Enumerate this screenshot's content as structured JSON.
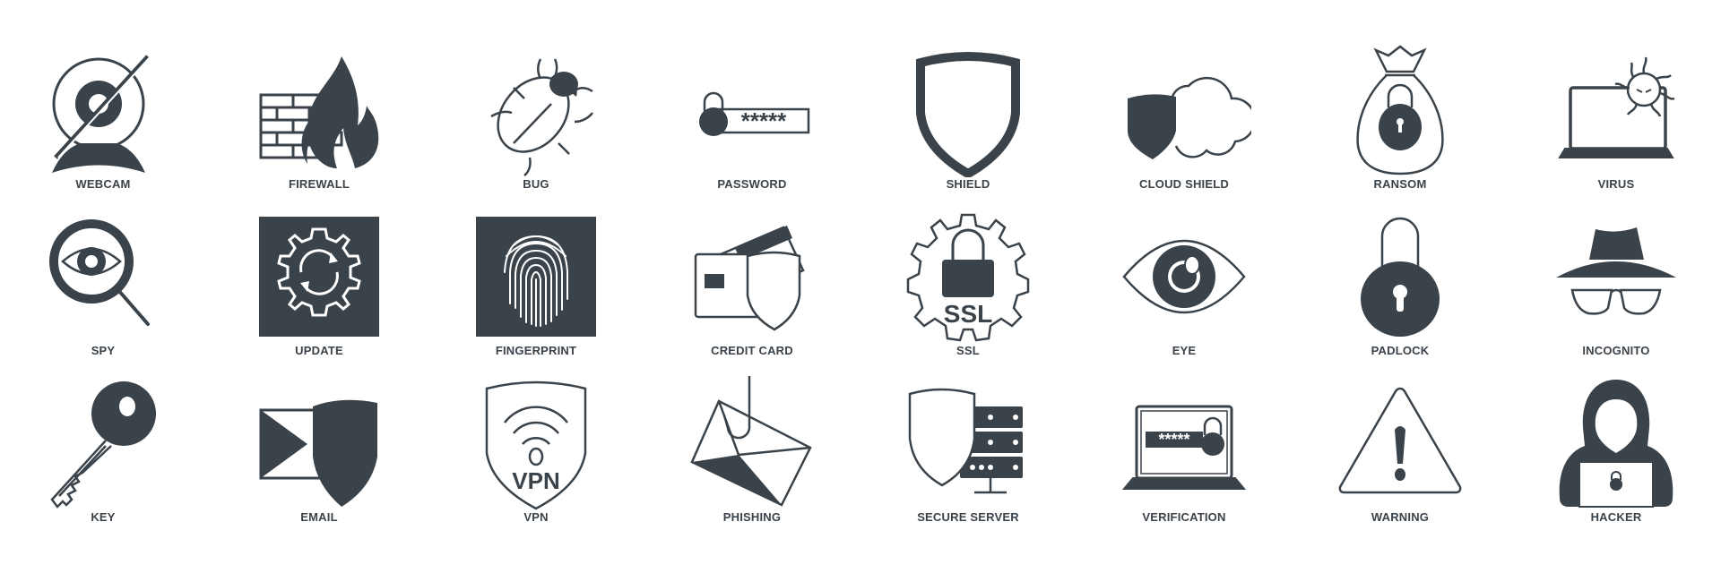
{
  "theme": {
    "icon_color": "#3a424a",
    "background": "#ffffff"
  },
  "rows": [
    [
      {
        "id": "webcam",
        "label": "WEBCAM",
        "icon": "webcam-off-icon"
      },
      {
        "id": "firewall",
        "label": "FIREWALL",
        "icon": "firewall-icon"
      },
      {
        "id": "bug",
        "label": "BUG",
        "icon": "bug-icon"
      },
      {
        "id": "password",
        "label": "PASSWORD",
        "icon": "password-icon",
        "mask": "*****"
      },
      {
        "id": "shield",
        "label": "SHIELD",
        "icon": "shield-icon"
      },
      {
        "id": "cloud-shield",
        "label": "CLOUD SHIELD",
        "icon": "cloud-shield-icon"
      },
      {
        "id": "ransom",
        "label": "RANSOM",
        "icon": "ransom-bag-icon"
      },
      {
        "id": "virus",
        "label": "VIRUS",
        "icon": "laptop-virus-icon"
      }
    ],
    [
      {
        "id": "spy",
        "label": "SPY",
        "icon": "spy-magnifier-eye-icon"
      },
      {
        "id": "update",
        "label": "UPDATE",
        "icon": "gear-update-icon"
      },
      {
        "id": "fingerprint",
        "label": "FINGERPRINT",
        "icon": "fingerprint-icon"
      },
      {
        "id": "credit-card",
        "label": "CREDIT CARD",
        "icon": "credit-card-shield-icon"
      },
      {
        "id": "ssl",
        "label": "SSL",
        "icon": "ssl-gear-lock-icon",
        "text": "SSL"
      },
      {
        "id": "eye",
        "label": "EYE",
        "icon": "eye-icon"
      },
      {
        "id": "padlock",
        "label": "PADLOCK",
        "icon": "padlock-icon"
      },
      {
        "id": "incognito",
        "label": "INCOGNITO",
        "icon": "incognito-icon"
      }
    ],
    [
      {
        "id": "key",
        "label": "KEY",
        "icon": "key-icon"
      },
      {
        "id": "email",
        "label": "EMAIL",
        "icon": "email-shield-icon"
      },
      {
        "id": "vpn",
        "label": "VPN",
        "icon": "vpn-shield-icon",
        "text": "VPN"
      },
      {
        "id": "phishing",
        "label": "PHISHING",
        "icon": "phishing-hook-icon"
      },
      {
        "id": "secure-server",
        "label": "SECURE SERVER",
        "icon": "secure-server-icon"
      },
      {
        "id": "verification",
        "label": "VERIFICATION",
        "icon": "laptop-verification-icon",
        "mask": "*****"
      },
      {
        "id": "warning",
        "label": "WARNING",
        "icon": "warning-icon"
      },
      {
        "id": "hacker",
        "label": "HACKER",
        "icon": "hacker-icon"
      }
    ]
  ]
}
